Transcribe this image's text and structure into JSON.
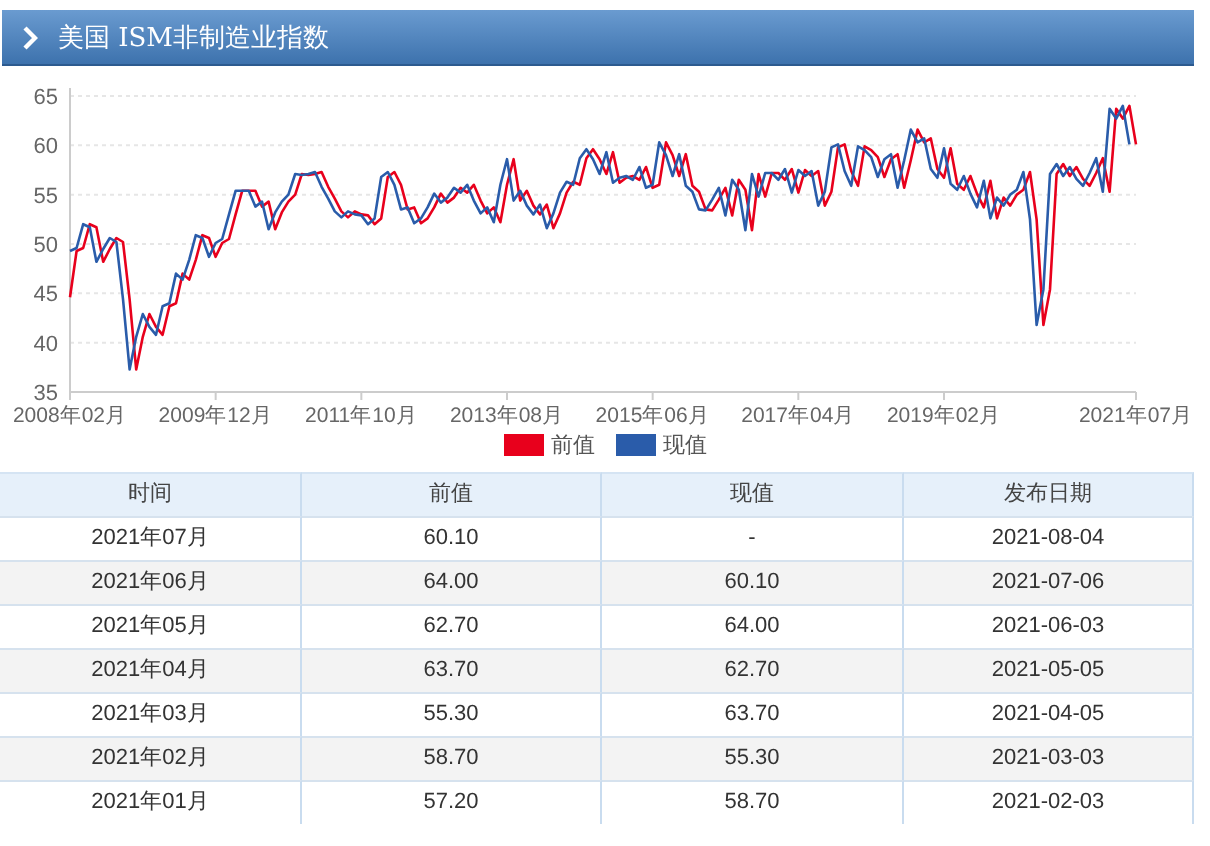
{
  "header": {
    "title": "美国 ISM非制造业指数"
  },
  "chart": {
    "chart_data": {
      "type": "line",
      "grid": true,
      "ylim": [
        35,
        65
      ],
      "yticks": [
        35,
        40,
        45,
        50,
        55,
        60,
        65
      ],
      "categories": [
        "2008年02月",
        null,
        null,
        null,
        null,
        null,
        null,
        null,
        null,
        null,
        null,
        null,
        null,
        null,
        null,
        null,
        null,
        null,
        null,
        null,
        null,
        null,
        "2009年12月",
        null,
        null,
        null,
        null,
        null,
        null,
        null,
        null,
        null,
        null,
        null,
        null,
        null,
        null,
        null,
        null,
        null,
        null,
        null,
        null,
        null,
        "2011年10月",
        null,
        null,
        null,
        null,
        null,
        null,
        null,
        null,
        null,
        null,
        null,
        null,
        null,
        null,
        null,
        null,
        null,
        null,
        null,
        null,
        null,
        "2013年08月",
        null,
        null,
        null,
        null,
        null,
        null,
        null,
        null,
        null,
        null,
        null,
        null,
        null,
        null,
        null,
        null,
        null,
        null,
        null,
        null,
        null,
        "2015年06月",
        null,
        null,
        null,
        null,
        null,
        null,
        null,
        null,
        null,
        null,
        null,
        null,
        null,
        null,
        null,
        null,
        null,
        null,
        null,
        null,
        null,
        "2017年04月",
        null,
        null,
        null,
        null,
        null,
        null,
        null,
        null,
        null,
        null,
        null,
        null,
        null,
        null,
        null,
        null,
        null,
        null,
        null,
        null,
        null,
        "2019年02月",
        null,
        null,
        null,
        null,
        null,
        null,
        null,
        null,
        null,
        null,
        null,
        null,
        null,
        null,
        null,
        null,
        null,
        null,
        null,
        null,
        null,
        null,
        null,
        null,
        null,
        null,
        null,
        null,
        "2021年07月"
      ],
      "series": [
        {
          "name": "前值",
          "color": "#e8001c",
          "values": [
            44.6,
            49.3,
            49.6,
            52.0,
            51.7,
            48.2,
            49.5,
            50.6,
            50.2,
            44.4,
            37.3,
            40.6,
            42.9,
            41.6,
            40.8,
            43.7,
            44.0,
            47.0,
            46.4,
            48.4,
            50.9,
            50.6,
            48.7,
            50.1,
            50.5,
            53.0,
            55.4,
            55.4,
            55.4,
            53.8,
            54.3,
            51.5,
            53.2,
            54.3,
            55.0,
            57.1,
            57.0,
            57.1,
            57.3,
            55.8,
            54.6,
            53.3,
            52.7,
            53.3,
            53.0,
            52.9,
            52.0,
            52.6,
            56.8,
            57.3,
            56.0,
            53.5,
            53.7,
            52.1,
            52.6,
            53.7,
            55.1,
            54.2,
            54.7,
            55.7,
            55.2,
            56.0,
            54.4,
            53.1,
            53.7,
            52.2,
            56.0,
            58.6,
            54.4,
            55.4,
            53.9,
            53.0,
            54.0,
            51.6,
            53.1,
            55.2,
            56.3,
            56.0,
            58.7,
            59.6,
            58.6,
            57.1,
            59.3,
            56.2,
            56.7,
            56.9,
            56.5,
            57.8,
            55.7,
            56.0,
            60.3,
            59.0,
            56.9,
            59.1,
            55.9,
            55.3,
            53.5,
            53.4,
            54.5,
            55.7,
            52.9,
            56.5,
            55.5,
            51.4,
            57.1,
            54.8,
            57.2,
            57.2,
            56.5,
            57.6,
            55.2,
            57.5,
            56.9,
            57.4,
            53.9,
            55.3,
            59.8,
            60.1,
            57.4,
            55.9,
            59.9,
            59.5,
            58.8,
            56.8,
            58.6,
            59.1,
            55.7,
            58.5,
            61.6,
            60.3,
            60.7,
            57.6,
            56.7,
            59.7,
            56.1,
            55.5,
            56.9,
            55.1,
            53.7,
            56.4,
            52.6,
            54.7,
            53.9,
            55.0,
            55.5,
            57.3,
            52.5,
            41.8,
            45.4,
            57.1,
            58.1,
            56.9,
            57.8,
            56.6,
            55.9,
            57.2,
            58.7,
            55.3,
            63.7,
            62.7,
            64.0,
            60.1
          ]
        },
        {
          "name": "现值",
          "color": "#2a5caa",
          "values": [
            49.3,
            49.6,
            52.0,
            51.7,
            48.2,
            49.5,
            50.6,
            50.2,
            44.4,
            37.3,
            40.6,
            42.9,
            41.6,
            40.8,
            43.7,
            44.0,
            47.0,
            46.4,
            48.4,
            50.9,
            50.6,
            48.7,
            50.1,
            50.5,
            53.0,
            55.4,
            55.4,
            55.4,
            53.8,
            54.3,
            51.5,
            53.2,
            54.3,
            55.0,
            57.1,
            57.0,
            57.1,
            57.3,
            55.8,
            54.6,
            53.3,
            52.7,
            53.3,
            53.0,
            52.9,
            52.0,
            52.6,
            56.8,
            57.3,
            56.0,
            53.5,
            53.7,
            52.1,
            52.6,
            53.7,
            55.1,
            54.2,
            54.7,
            55.7,
            55.2,
            56.0,
            54.4,
            53.1,
            53.7,
            52.2,
            56.0,
            58.6,
            54.4,
            55.4,
            53.9,
            53.0,
            54.0,
            51.6,
            53.1,
            55.2,
            56.3,
            56.0,
            58.7,
            59.6,
            58.6,
            57.1,
            59.3,
            56.2,
            56.7,
            56.9,
            56.5,
            57.8,
            55.7,
            56.0,
            60.3,
            59.0,
            56.9,
            59.1,
            55.9,
            55.3,
            53.5,
            53.4,
            54.5,
            55.7,
            52.9,
            56.5,
            55.5,
            51.4,
            57.1,
            54.8,
            57.2,
            57.2,
            56.5,
            57.6,
            55.2,
            57.5,
            56.9,
            57.4,
            53.9,
            55.3,
            59.8,
            60.1,
            57.4,
            55.9,
            59.9,
            59.5,
            58.8,
            56.8,
            58.6,
            59.1,
            55.7,
            58.5,
            61.6,
            60.3,
            60.7,
            57.6,
            56.7,
            59.7,
            56.1,
            55.5,
            56.9,
            55.1,
            53.7,
            56.4,
            52.6,
            54.7,
            53.9,
            55.0,
            55.5,
            57.3,
            52.5,
            41.8,
            45.4,
            57.1,
            58.1,
            56.9,
            57.8,
            56.6,
            55.9,
            57.2,
            58.7,
            55.3,
            63.7,
            62.7,
            64.0,
            60.1,
            null
          ]
        }
      ]
    }
  },
  "table": {
    "columns": [
      "时间",
      "前值",
      "现值",
      "发布日期"
    ],
    "rows": [
      [
        "2021年07月",
        "60.10",
        "-",
        "2021-08-04"
      ],
      [
        "2021年06月",
        "64.00",
        "60.10",
        "2021-07-06"
      ],
      [
        "2021年05月",
        "62.70",
        "64.00",
        "2021-06-03"
      ],
      [
        "2021年04月",
        "63.70",
        "62.70",
        "2021-05-05"
      ],
      [
        "2021年03月",
        "55.30",
        "63.70",
        "2021-04-05"
      ],
      [
        "2021年02月",
        "58.70",
        "55.30",
        "2021-03-03"
      ],
      [
        "2021年01月",
        "57.20",
        "58.70",
        "2021-02-03"
      ]
    ]
  }
}
